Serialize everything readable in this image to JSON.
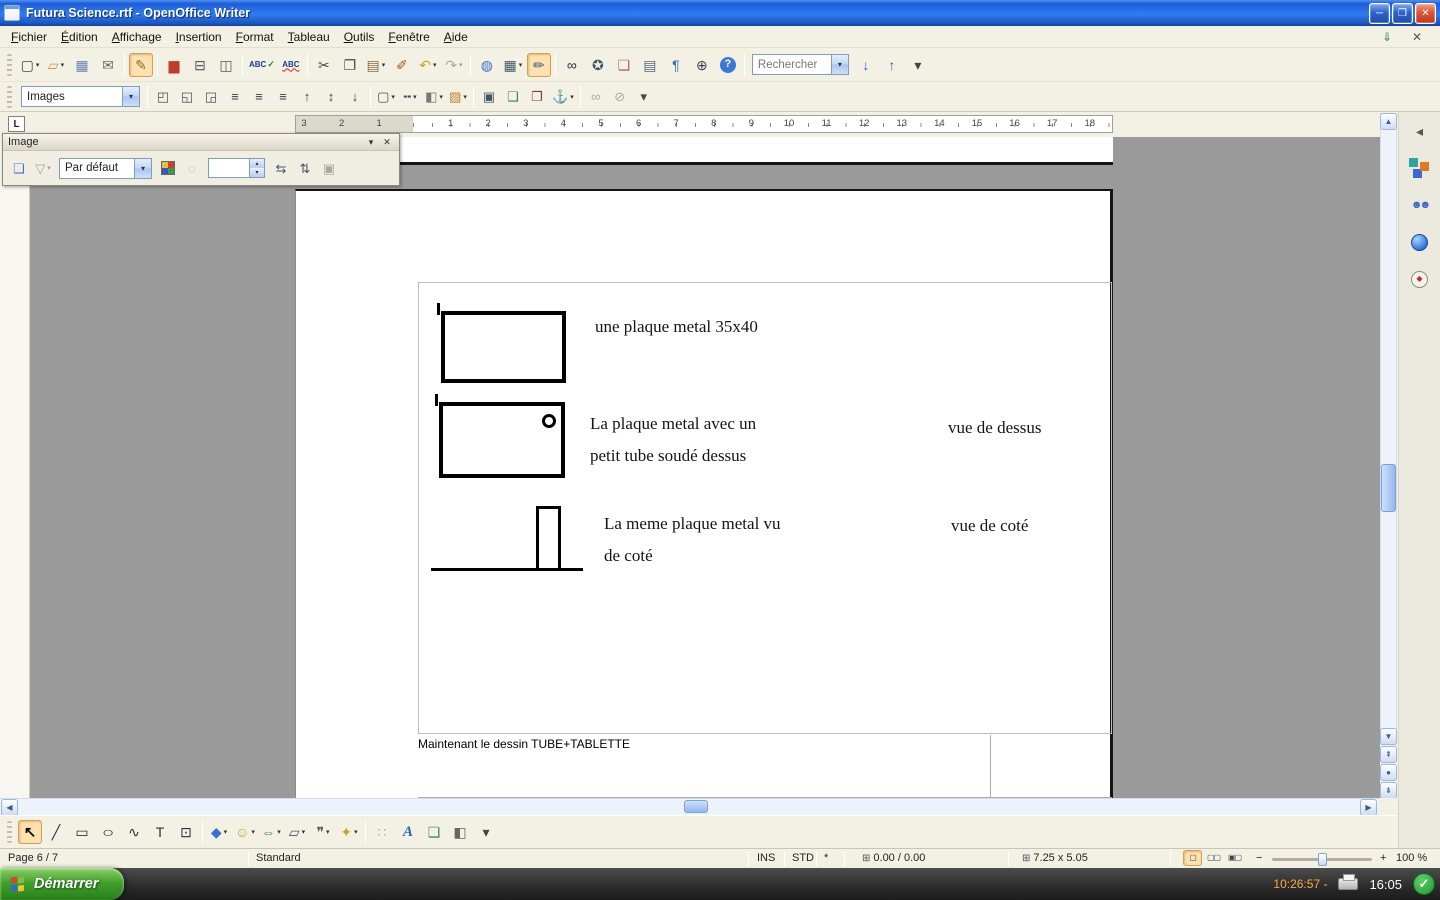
{
  "colors": {
    "titlebar_blue": "#1e5ed8",
    "doc_gray": "#9a9a9a",
    "start_green": "#3f9e2a",
    "tray_orange": "#ffaa3c",
    "check_green": "#1f9733"
  },
  "glyphs": {
    "dropdown": "▾",
    "spin_up": "▴",
    "spin_down": "▾"
  },
  "window": {
    "title": "Futura Science.rtf - OpenOffice Writer",
    "buttons": {
      "minimize": "─",
      "maximize": "❐",
      "close": "✕"
    }
  },
  "menubar": {
    "items": [
      "Fichier",
      "Édition",
      "Affichage",
      "Insertion",
      "Format",
      "Tableau",
      "Outils",
      "Fenêtre",
      "Aide"
    ],
    "right_icons": [
      {
        "name": "load-url",
        "glyph": "⇓",
        "color": "#3a8a3a"
      },
      {
        "name": "close-document",
        "glyph": "✕",
        "color": "#555"
      }
    ]
  },
  "standard_toolbar": {
    "items": [
      {
        "name": "new-document",
        "glyph": "▢",
        "color": "#445",
        "dd": true
      },
      {
        "name": "open",
        "glyph": "▱",
        "color": "#c9972e",
        "dd": true
      },
      {
        "name": "save",
        "glyph": "▦",
        "color": "#6b83b5"
      },
      {
        "name": "document-as-email",
        "glyph": "✉",
        "color": "#666"
      },
      {
        "sep": true
      },
      {
        "name": "edit-file",
        "glyph": "✎",
        "color": "#8a6d2a",
        "state": "pressed"
      },
      {
        "sep": true
      },
      {
        "name": "export-pdf",
        "glyph": "▆",
        "color": "#c23a28"
      },
      {
        "name": "print",
        "glyph": "⊟",
        "color": "#556"
      },
      {
        "name": "page-preview",
        "glyph": "◫",
        "color": "#556"
      },
      {
        "sep": true
      },
      {
        "name": "spellcheck",
        "glyph": "ABC"
      },
      {
        "name": "autospellcheck",
        "glyph": "ABC"
      },
      {
        "sep": true
      },
      {
        "name": "cut",
        "glyph": "✂",
        "color": "#445"
      },
      {
        "name": "copy",
        "glyph": "❐",
        "color": "#445"
      },
      {
        "name": "paste",
        "glyph": "▤",
        "color": "#8a6d3b",
        "dd": true
      },
      {
        "name": "format-paintbrush",
        "glyph": "✐",
        "color": "#a05a2a"
      },
      {
        "name": "undo",
        "glyph": "↶",
        "color": "#c9a227",
        "dd": true
      },
      {
        "name": "redo",
        "glyph": "↷",
        "state": "disabled",
        "dd": true
      },
      {
        "sep": true
      },
      {
        "name": "hyperlink",
        "glyph": "◍",
        "color": "#3a6fc8"
      },
      {
        "name": "table",
        "glyph": "▦",
        "color": "#456",
        "dd": true
      },
      {
        "name": "draw-functions",
        "glyph": "✏",
        "color": "#357",
        "state": "pressed"
      },
      {
        "sep": true
      },
      {
        "name": "find-replace",
        "glyph": "∞",
        "color": "#234"
      },
      {
        "name": "navigator",
        "glyph": "✪",
        "color": "#456"
      },
      {
        "name": "gallery",
        "glyph": "❏",
        "color": "#b05a8a"
      },
      {
        "name": "data-sources",
        "glyph": "▤",
        "color": "#567"
      },
      {
        "name": "nonprinting-characters",
        "glyph": "¶",
        "color": "#3a6fc8"
      },
      {
        "name": "zoom",
        "glyph": "⊕",
        "color": "#345"
      },
      {
        "name": "help",
        "glyph": "?"
      },
      {
        "sep": true
      }
    ],
    "search": {
      "value": "Rechercher"
    },
    "after_search": [
      {
        "name": "find-next",
        "glyph": "↓",
        "color": "#2a62c4"
      },
      {
        "name": "find-previous",
        "glyph": "↑",
        "color": "#2a62c4"
      },
      {
        "name": "toolbar-overflow",
        "glyph": "▾"
      }
    ]
  },
  "formatting_toolbar": {
    "style_combo": "Images",
    "items": [
      {
        "sep": true
      },
      {
        "name": "wrap-off",
        "glyph": "◰",
        "color": "#456"
      },
      {
        "name": "wrap-on",
        "glyph": "◱",
        "color": "#456"
      },
      {
        "name": "wrap-through",
        "glyph": "◲",
        "color": "#456"
      },
      {
        "name": "align-left",
        "glyph": "≡",
        "color": "#345"
      },
      {
        "name": "align-center",
        "glyph": "≡",
        "color": "#345"
      },
      {
        "name": "align-right",
        "glyph": "≡",
        "color": "#345"
      },
      {
        "name": "align-top",
        "glyph": "↑",
        "color": "#345"
      },
      {
        "name": "align-middle",
        "glyph": "↕",
        "color": "#345"
      },
      {
        "name": "align-bottom",
        "glyph": "↓",
        "color": "#345"
      },
      {
        "sep": true
      },
      {
        "name": "borders",
        "glyph": "▢",
        "color": "#456",
        "dd": true
      },
      {
        "name": "line-style",
        "glyph": "╍",
        "color": "#456",
        "dd": true
      },
      {
        "name": "border-color",
        "glyph": "◧",
        "color": "#777",
        "dd": true
      },
      {
        "name": "background-color",
        "glyph": "▨",
        "color": "#c08030",
        "dd": true
      },
      {
        "sep": true
      },
      {
        "name": "frame-properties",
        "glyph": "▣",
        "color": "#456"
      },
      {
        "name": "bring-to-front",
        "glyph": "❏",
        "color": "#383"
      },
      {
        "name": "send-to-back",
        "glyph": "❐",
        "color": "#833"
      },
      {
        "name": "change-anchor",
        "glyph": "⚓",
        "color": "#345",
        "dd": true
      },
      {
        "sep": true
      },
      {
        "name": "link-frames",
        "glyph": "∞",
        "state": "disabled"
      },
      {
        "name": "unlink-frames",
        "glyph": "⊘",
        "state": "disabled"
      },
      {
        "name": "toolbar-overflow",
        "glyph": "▾"
      }
    ]
  },
  "ruler": {
    "tab_selector": "L",
    "left_numbers": [
      "3",
      "2",
      "1"
    ],
    "numbers": [
      "1",
      "2",
      "3",
      "4",
      "5",
      "6",
      "7",
      "8",
      "9",
      "10",
      "11",
      "12",
      "13",
      "14",
      "15",
      "16",
      "17",
      "18"
    ]
  },
  "image_toolbar": {
    "title": "Image",
    "title_buttons": {
      "menu": "▾",
      "close": "✕"
    },
    "items_a": [
      {
        "name": "from-file",
        "glyph": "❏",
        "color": "#3b74c8"
      },
      {
        "name": "graphics-filter",
        "glyph": "▽",
        "dd": true,
        "state": "disabled"
      }
    ],
    "combo": "Par défaut",
    "items_b": [
      {
        "name": "graphics-mode",
        "css": "swatch-grid"
      },
      {
        "name": "transparency",
        "glyph": "◌",
        "state": "disabled"
      }
    ],
    "spin_value": "",
    "items_c": [
      {
        "name": "flip-horizontal",
        "glyph": "⇆",
        "color": "#456"
      },
      {
        "name": "flip-vertical",
        "glyph": "⇅",
        "color": "#456"
      },
      {
        "name": "frame-properties",
        "glyph": "▣",
        "state": "disabled"
      }
    ]
  },
  "page": {
    "captions": {
      "c1": "une plaque metal 35x40",
      "c2a": "La plaque metal avec un",
      "c2b": "petit tube soudé dessus",
      "v1": "vue de dessus",
      "c3a": "La meme plaque metal vu",
      "c3b": "de coté",
      "v2": "vue de coté",
      "note": "Maintenant le dessin TUBE+TABLETTE"
    }
  },
  "right_strip": {
    "items": [
      {
        "name": "panel-float",
        "glyph": "◂",
        "color": "#555"
      },
      {
        "name": "shortcut-modules",
        "css": "icon-cubes"
      },
      {
        "name": "shortcut-users",
        "glyph": "☻☻",
        "css": "icon-users"
      },
      {
        "name": "shortcut-globe",
        "css": "icon-globe"
      },
      {
        "name": "shortcut-compass",
        "glyph": "◆",
        "css": "icon-compass",
        "color": "#c03030"
      }
    ]
  },
  "scrollbars": {
    "up": "▲",
    "down": "▼",
    "left": "◀",
    "right": "▶",
    "nav_up": "⇞",
    "nav_dot": "●",
    "nav_down": "⇟"
  },
  "drawing_toolbar": {
    "items": [
      {
        "name": "select",
        "glyph": "↖",
        "color": "#111",
        "state": "pressed"
      },
      {
        "name": "line",
        "glyph": "╱",
        "color": "#234"
      },
      {
        "name": "rectangle",
        "glyph": "▭",
        "color": "#234"
      },
      {
        "name": "ellipse",
        "glyph": "○",
        "color": "#234"
      },
      {
        "name": "freeform",
        "glyph": "∿",
        "color": "#234"
      },
      {
        "name": "text",
        "glyph": "T",
        "color": "#234"
      },
      {
        "name": "callout",
        "glyph": "⊡",
        "color": "#234"
      },
      {
        "sep": true
      },
      {
        "name": "basic-shapes",
        "glyph": "◆",
        "color": "#3a6fd0",
        "dd": true
      },
      {
        "name": "symbol-shapes",
        "glyph": "☺",
        "color": "#c9a227",
        "dd": true
      },
      {
        "name": "block-arrows",
        "glyph": "⇔",
        "color": "#3a8a4a",
        "dd": true
      },
      {
        "name": "flowcharts",
        "glyph": "▱",
        "color": "#456",
        "dd": true
      },
      {
        "name": "callouts",
        "glyph": "❞",
        "color": "#456",
        "dd": true
      },
      {
        "name": "stars",
        "glyph": "✦",
        "color": "#c9a227",
        "dd": true
      },
      {
        "sep": true
      },
      {
        "name": "edit-points",
        "glyph": "∷",
        "state": "disabled"
      },
      {
        "name": "fontwork-gallery",
        "glyph": "A"
      },
      {
        "name": "picture-from-file",
        "glyph": "❏",
        "color": "#3a8a5a"
      },
      {
        "name": "extrusion",
        "glyph": "◧",
        "color": "#666"
      },
      {
        "name": "toolbar-overflow",
        "glyph": "▾"
      }
    ]
  },
  "statusbar": {
    "page": "Page 6 / 7",
    "style": "Standard",
    "insert_mode": "INS",
    "selection_mode": "STD",
    "modified": "*",
    "position_icon": "⊞",
    "position": "0.00 / 0.00",
    "size_icon": "⊞",
    "size": "7.25 x 5.05",
    "view_buttons": [
      {
        "name": "view-single-page",
        "glyph": "▢",
        "state": "pressed"
      },
      {
        "name": "view-multi-page",
        "glyph": "▢▢"
      },
      {
        "name": "view-book",
        "glyph": "▣▢"
      }
    ],
    "minus": "−",
    "plus": "+",
    "zoom": "100 %"
  },
  "taskbar": {
    "start": "Démarrer",
    "time": "10:26:57 -",
    "clock": "16:05",
    "check": "✓"
  }
}
